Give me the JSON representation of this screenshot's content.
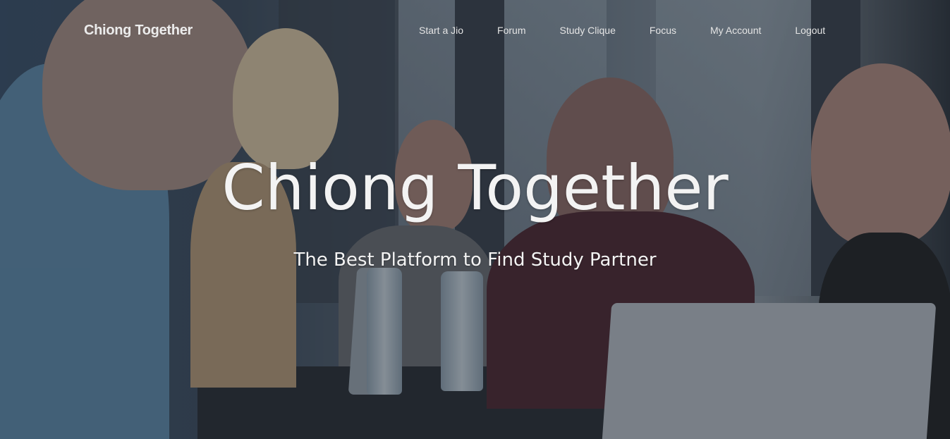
{
  "navbar": {
    "brand": "Chiong Together",
    "links": [
      "Start a Jio",
      "Forum",
      "Study Clique",
      "Focus",
      "My Account",
      "Logout"
    ]
  },
  "hero": {
    "title": "Chiong Together",
    "subtitle": "The Best Platform to Find Study Partner"
  }
}
